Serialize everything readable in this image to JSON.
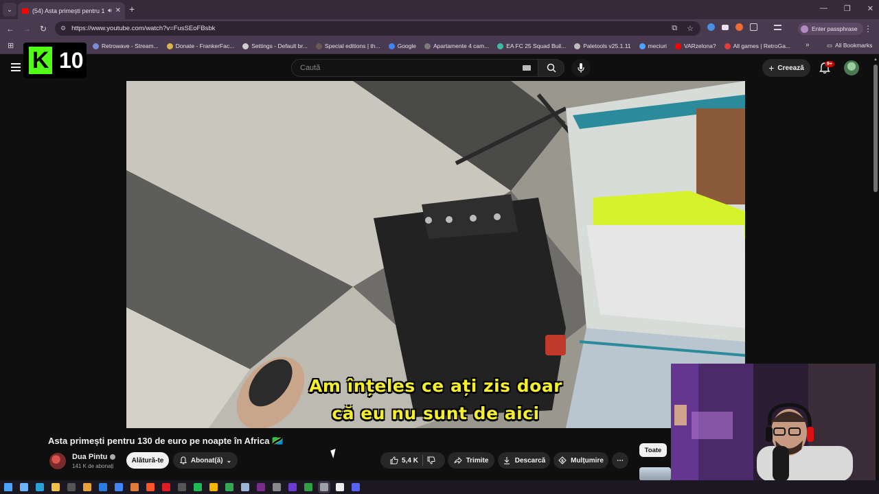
{
  "browser": {
    "tab": {
      "title": "(54) Asta primești pentru 13",
      "audio_icon": "speaker-icon",
      "close": "✕"
    },
    "new_tab": "+",
    "window_controls": [
      "—",
      "❐",
      "✕"
    ],
    "url": "https://www.youtube.com/watch?v=FusSEoFBsbk",
    "passphrase_button": "Enter passphrase",
    "bookmarks": [
      {
        "label": "Retrowave - Stream...",
        "color": "#7b8bd6"
      },
      {
        "label": "Donate - FrankerFac...",
        "color": "#d9b44a"
      },
      {
        "label": "Settings - Default br...",
        "color": "#cfcfcf"
      },
      {
        "label": "Special editions | th...",
        "color": "#6d5a4e"
      },
      {
        "label": "Google",
        "color": "#4285f4"
      },
      {
        "label": "Apartamente 4 cam...",
        "color": "#7a7a7a"
      },
      {
        "label": "EA FC 25 Squad Buil...",
        "color": "#3fb8a6"
      },
      {
        "label": "Paletools v25.1.11",
        "color": "#bdbdbd"
      },
      {
        "label": "meciuri",
        "color": "#4aa3ff"
      },
      {
        "label": "VARzelona?",
        "color": "#ff0000"
      },
      {
        "label": "All games | RetroGa...",
        "color": "#e23c3c"
      }
    ],
    "all_bookmarks": "All Bookmarks"
  },
  "overlay": {
    "kick_logo": "K",
    "kick_count": "10"
  },
  "youtube": {
    "search_placeholder": "Caută",
    "create_label": "Creează",
    "notifications_badge": "9+",
    "video": {
      "caption_line1": "Am înțeles ce ați zis doar",
      "caption_line2": "că eu nu sunt de aici"
    },
    "title": "Asta primești pentru 130 de euro pe noapte în Africa 🇹🇿",
    "channel": {
      "name": "Dua Pintu",
      "subscribers": "141 K de abonați"
    },
    "join_label": "Alătură-te",
    "subscribed_label": "Abonat(ă)",
    "likes": "5,4 K",
    "share_label": "Trimite",
    "download_label": "Descarcă",
    "thanks_label": "Mulțumire",
    "filter_chip": "Toate"
  },
  "taskbar": {
    "icons": [
      {
        "name": "start-icon",
        "color": "#4aa3ff"
      },
      {
        "name": "copilot-icon",
        "color": "#6fb3ff"
      },
      {
        "name": "edge-icon",
        "color": "#2aa0d8"
      },
      {
        "name": "explorer-icon",
        "color": "#f0c24a"
      },
      {
        "name": "ps-icon",
        "color": "#555555"
      },
      {
        "name": "shield-icon",
        "color": "#e7a23a"
      },
      {
        "name": "app-icon",
        "color": "#2a7de1"
      },
      {
        "name": "chrome-icon",
        "color": "#4285f4"
      },
      {
        "name": "a-icon",
        "color": "#e07b39"
      },
      {
        "name": "brave-icon",
        "color": "#fb542b"
      },
      {
        "name": "red-icon",
        "color": "#e01b24"
      },
      {
        "name": "obs-icon",
        "color": "#555555"
      },
      {
        "name": "spotify-icon",
        "color": "#1db954"
      },
      {
        "name": "chrome2-icon",
        "color": "#f4b400"
      },
      {
        "name": "chrome3-icon",
        "color": "#34a853"
      },
      {
        "name": "steam-icon",
        "color": "#9cb5d6"
      },
      {
        "name": "purple-icon",
        "color": "#7a2a8a"
      },
      {
        "name": "folder-icon",
        "color": "#888888"
      },
      {
        "name": "violet-icon",
        "color": "#6a3cd0"
      },
      {
        "name": "green-icon",
        "color": "#2ea043"
      },
      {
        "name": "chrome-active-icon",
        "color": "#9aa0a6",
        "active": true
      },
      {
        "name": "capcut-icon",
        "color": "#eeeeee"
      },
      {
        "name": "discord-icon",
        "color": "#5865f2"
      }
    ]
  }
}
